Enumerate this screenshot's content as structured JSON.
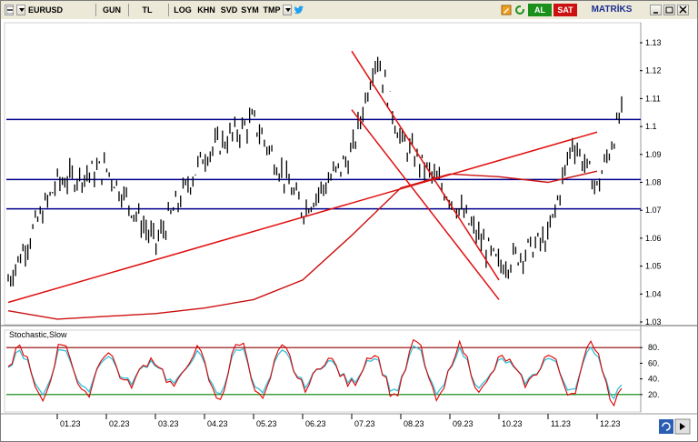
{
  "toolbar": {
    "symbol": "EURUSD",
    "period": "GUN",
    "currency": "TL",
    "scale": "LOG",
    "buttons": [
      "KHN",
      "SVD",
      "SYM",
      "TMP"
    ],
    "buy_label": "AL",
    "sell_label": "SAT",
    "brand": "MATRİKS",
    "icons": [
      "menu-arrow-icon",
      "twitter-icon",
      "pencil-icon",
      "refresh-icon",
      "help-icon",
      "minimize-icon",
      "maximize-icon",
      "close-icon"
    ]
  },
  "price_axis": {
    "ticks": [
      "1.13",
      "1.12",
      "1.11",
      "1.1",
      "1.09",
      "1.08",
      "1.07",
      "1.06",
      "1.05",
      "1.04",
      "1.03"
    ]
  },
  "stoch_axis": {
    "ticks": [
      "80.",
      "60.",
      "40.",
      "20."
    ]
  },
  "time_axis": {
    "ticks": [
      "01.23",
      "02.23",
      "03.23",
      "04.23",
      "05.23",
      "06.23",
      "07.23",
      "08.23",
      "09.23",
      "10.23",
      "11.23",
      "12.23"
    ]
  },
  "indicator": {
    "label": "Stochastic,Slow"
  },
  "colors": {
    "candles": "#000000",
    "support_lines": "#00008b",
    "trend_lines": "#e01010",
    "moving_average": "#cc1010",
    "stoch_k": "#dd0000",
    "stoch_d": "#33c0d8",
    "stoch_upper": "#8b0000",
    "stoch_lower": "#008000",
    "buy": "#1a8f1a",
    "sell": "#cc1010"
  },
  "chart_data": {
    "type": "candlestick",
    "symbol": "EURUSD",
    "period": "daily",
    "ylim": [
      1.03,
      1.13
    ],
    "horizontal_levels": [
      1.1025,
      1.081,
      1.0705
    ],
    "trend_lines": [
      {
        "from": [
          "12.22",
          1.037
        ],
        "to": [
          "12.23",
          1.098
        ]
      },
      {
        "from": [
          "07.23",
          1.127
        ],
        "to": [
          "10.23",
          1.045
        ]
      },
      {
        "from": [
          "07.23",
          1.106
        ],
        "to": [
          "10.23",
          1.038
        ]
      }
    ],
    "moving_average_approx": [
      {
        "x": "12.22",
        "y": 1.034
      },
      {
        "x": "01.23",
        "y": 1.031
      },
      {
        "x": "02.23",
        "y": 1.032
      },
      {
        "x": "03.23",
        "y": 1.033
      },
      {
        "x": "04.23",
        "y": 1.035
      },
      {
        "x": "05.23",
        "y": 1.038
      },
      {
        "x": "06.23",
        "y": 1.045
      },
      {
        "x": "07.23",
        "y": 1.061
      },
      {
        "x": "08.23",
        "y": 1.078
      },
      {
        "x": "09.23",
        "y": 1.083
      },
      {
        "x": "10.23",
        "y": 1.082
      },
      {
        "x": "11.23",
        "y": 1.08
      },
      {
        "x": "12.23",
        "y": 1.084
      }
    ],
    "close_approx": [
      {
        "x": "12.22",
        "y": 1.045
      },
      {
        "x": "01.23",
        "y": 1.08
      },
      {
        "x": "02.23",
        "y": 1.085
      },
      {
        "x": "03.23",
        "y": 1.058
      },
      {
        "x": "04.23",
        "y": 1.09
      },
      {
        "x": "05.23",
        "y": 1.102
      },
      {
        "x": "06.23",
        "y": 1.07
      },
      {
        "x": "07.23",
        "y": 1.09
      },
      {
        "x": "07.23",
        "y": 1.126
      },
      {
        "x": "08.23",
        "y": 1.095
      },
      {
        "x": "09.23",
        "y": 1.075
      },
      {
        "x": "10.23",
        "y": 1.05
      },
      {
        "x": "11.23",
        "y": 1.06
      },
      {
        "x": "11.23",
        "y": 1.095
      },
      {
        "x": "12.23",
        "y": 1.078
      },
      {
        "x": "12.23",
        "y": 1.105
      }
    ],
    "stochastic": {
      "name": "Stochastic,Slow",
      "ylim": [
        0,
        100
      ],
      "levels": [
        80,
        20
      ]
    }
  }
}
